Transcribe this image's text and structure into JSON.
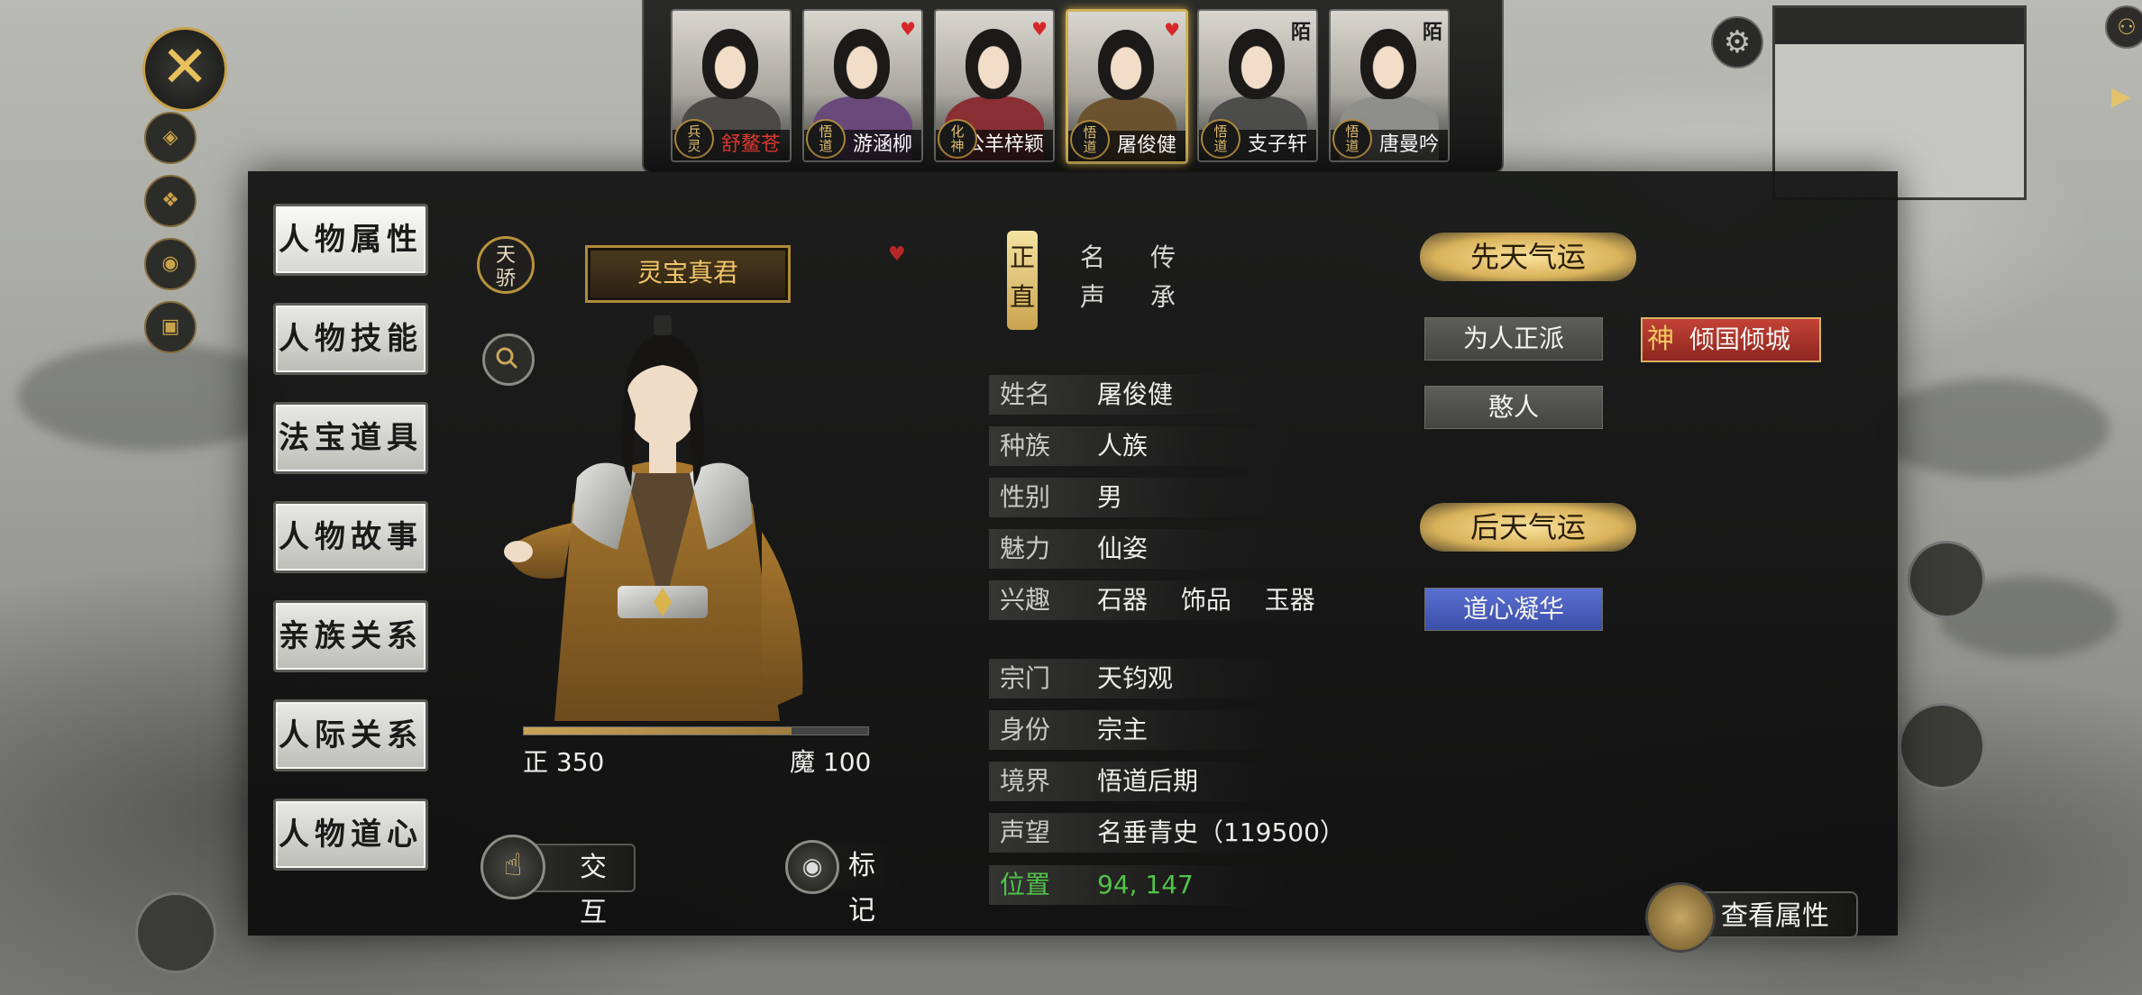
{
  "roster": [
    {
      "name": "舒鳌苍",
      "tag": "兵\n灵",
      "name_color": "red",
      "mark": ""
    },
    {
      "name": "游涵柳",
      "tag": "悟\n道",
      "name_color": "white",
      "mark": "heart"
    },
    {
      "name": "公羊梓颖",
      "tag": "化\n神",
      "name_color": "white",
      "mark": "heart"
    },
    {
      "name": "屠俊健",
      "tag": "悟\n道",
      "name_color": "white",
      "mark": "heart",
      "selected": true
    },
    {
      "name": "支子轩",
      "tag": "悟\n道",
      "name_color": "white",
      "mark": "陌"
    },
    {
      "name": "唐曼吟",
      "tag": "悟\n道",
      "name_color": "white",
      "mark": "陌"
    }
  ],
  "tabs": [
    "人物属性",
    "人物技能",
    "法宝道具",
    "人物故事",
    "亲族关系",
    "人际关系",
    "人物道心"
  ],
  "rank_badge": "天\n骄",
  "title": "灵宝真君",
  "alignment": {
    "righteous_label": "正 350",
    "demonic_label": "魔 100",
    "righteous": 350,
    "demonic": 100
  },
  "actions": {
    "interact": "交互",
    "mark": "标记"
  },
  "virtue_tabs": [
    {
      "label": "正\n直",
      "active": true
    },
    {
      "label": "名\n声",
      "active": false
    },
    {
      "label": "传\n承",
      "active": false
    }
  ],
  "info": [
    {
      "key": "姓名",
      "value": "屠俊健"
    },
    {
      "key": "种族",
      "value": "人族"
    },
    {
      "key": "性别",
      "value": "男"
    },
    {
      "key": "魅力",
      "value": "仙姿"
    },
    {
      "key": "兴趣",
      "value": "石器　 饰品　 玉器"
    },
    {
      "key": "宗门",
      "value": "天钧观"
    },
    {
      "key": "身份",
      "value": "宗主"
    },
    {
      "key": "境界",
      "value": "悟道后期"
    },
    {
      "key": "声望",
      "value": "名垂青史（119500）"
    },
    {
      "key": "位置",
      "value": "94, 147",
      "highlight": "green"
    }
  ],
  "innate_fortune": {
    "heading": "先天气运",
    "traits": [
      {
        "label": "为人正派",
        "style": "grey"
      },
      {
        "label": "倾国倾城",
        "style": "red",
        "mark": "神"
      },
      {
        "label": "憨人",
        "style": "grey"
      }
    ]
  },
  "acquired_fortune": {
    "heading": "后天气运",
    "traits": [
      {
        "label": "道心凝华",
        "style": "blue"
      }
    ]
  },
  "view_attributes": "查看属性",
  "colors": {
    "gold": "#d2b15a",
    "green": "#52c34a",
    "panel": "#141514",
    "trait_blue": "#4a5fc0",
    "trait_red": "#b0392f"
  },
  "icons": [
    "close-icon",
    "gear-icon",
    "search-icon",
    "hand-icon",
    "eye-icon",
    "arrow-right-icon",
    "group-icon"
  ]
}
